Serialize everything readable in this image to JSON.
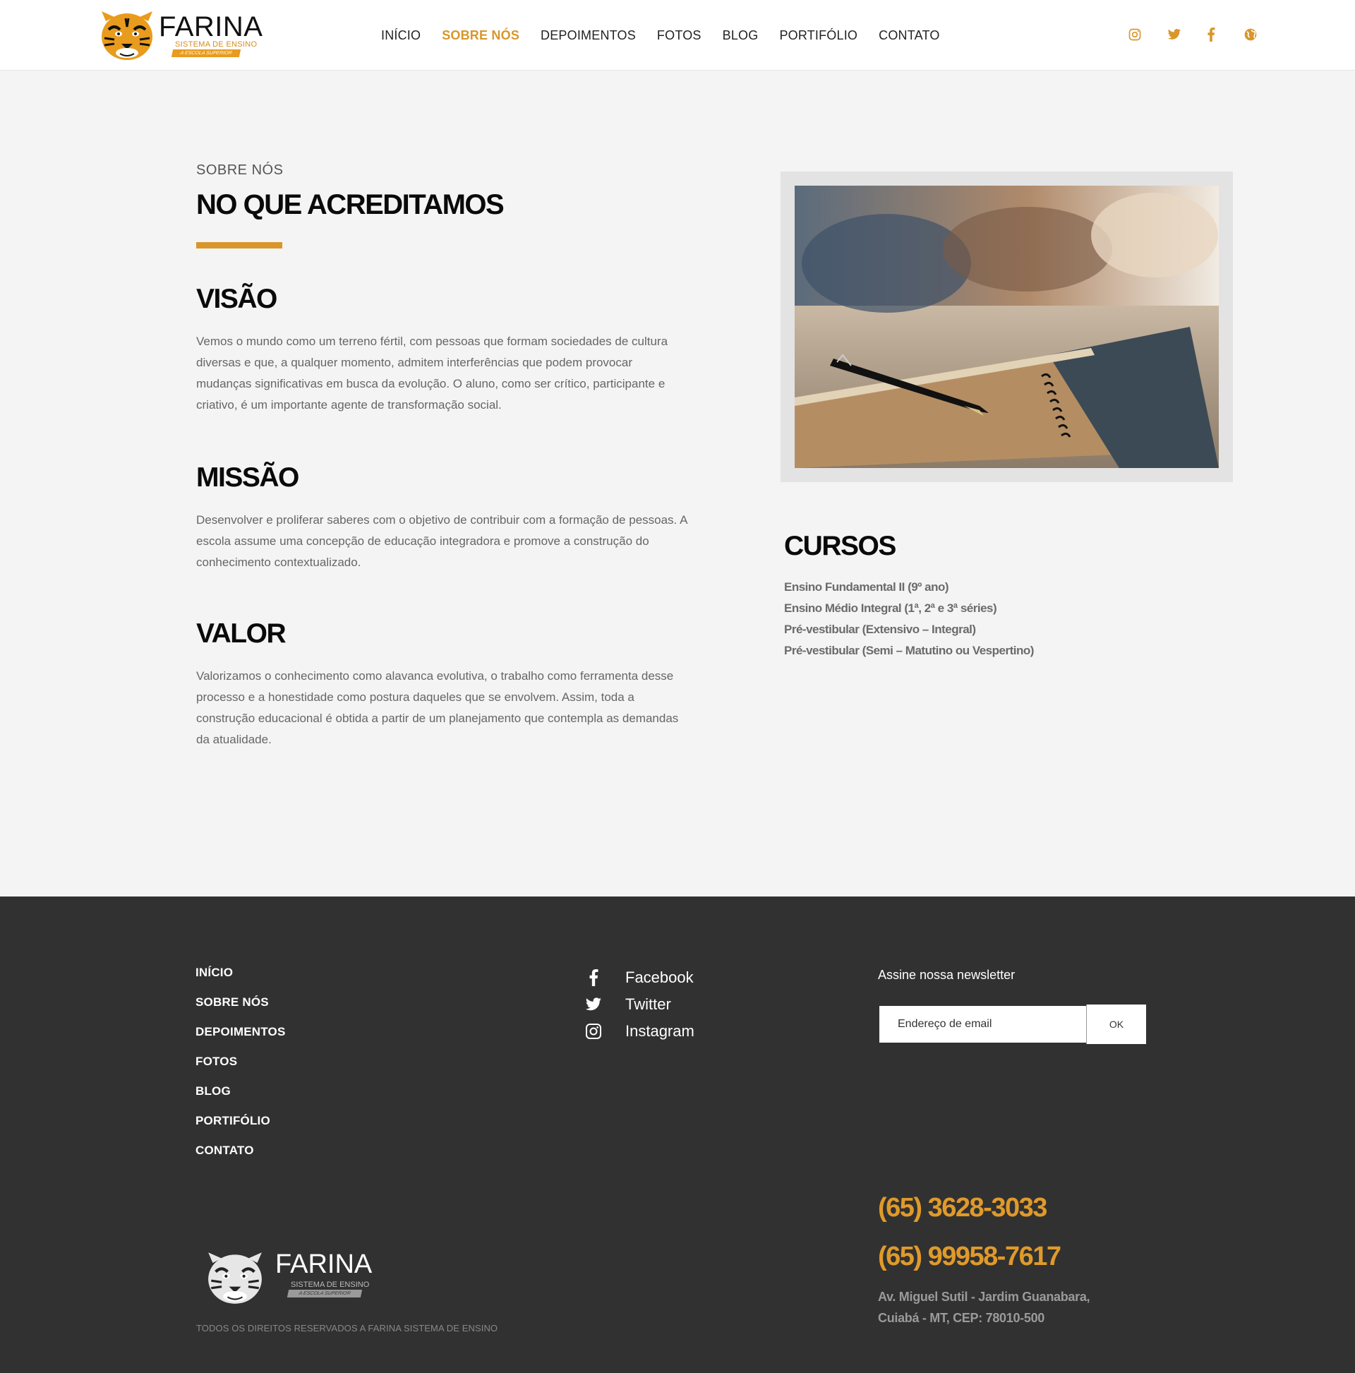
{
  "brand": {
    "name": "FARINA",
    "subtitle": "SISTEMA DE ENSINO",
    "tagline": "A ESCOLA SUPERIOR",
    "accent_color": "#d9962a"
  },
  "nav": {
    "items": [
      {
        "label": "INÍCIO",
        "active": false
      },
      {
        "label": "SOBRE NÓS",
        "active": true
      },
      {
        "label": "DEPOIMENTOS",
        "active": false
      },
      {
        "label": "FOTOS",
        "active": false
      },
      {
        "label": "BLOG",
        "active": false
      },
      {
        "label": "PORTIFÓLIO",
        "active": false
      },
      {
        "label": "CONTATO",
        "active": false
      }
    ],
    "social_icons": [
      "instagram-icon",
      "twitter-icon",
      "facebook-icon",
      "globe-icon"
    ]
  },
  "about": {
    "label": "SOBRE NÓS",
    "title": "NO QUE ACREDITAMOS",
    "blocks": [
      {
        "title": "VISÃO",
        "text": "Vemos o mundo como um terreno fértil, com pessoas que formam sociedades de cultura diversas e que, a qualquer momento, admitem interferências que podem provocar mudanças significativas em busca da evolução. O aluno, como ser crítico, participante e criativo, é um importante agente de transformação social."
      },
      {
        "title": "MISSÃO",
        "text": "Desenvolver e proliferar saberes com o objetivo de contribuir com a formação de pessoas. A escola assume uma concepção de educação integradora e promove a construção do conhecimento contextualizado."
      },
      {
        "title": "VALOR",
        "text": "Valorizamos o conhecimento como alavanca evolutiva, o trabalho como ferramenta desse processo e a honestidade como postura daqueles que se envolvem. Assim, toda a construção educacional é obtida a partir de um planejamento que contempla as demandas da atualidade."
      }
    ]
  },
  "cursos": {
    "title": "CURSOS",
    "items": [
      "Ensino Fundamental II (9º ano)",
      "Ensino Médio Integral (1ª, 2ª e 3ª séries)",
      "Pré-vestibular (Extensivo – Integral)",
      "Pré-vestibular (Semi – Matutino ou Vespertino)"
    ]
  },
  "footer": {
    "nav": [
      "INÍCIO",
      "SOBRE NÓS",
      "DEPOIMENTOS",
      "FOTOS",
      "BLOG",
      "PORTIFÓLIO",
      "CONTATO"
    ],
    "social": [
      {
        "icon": "facebook-icon",
        "label": "Facebook"
      },
      {
        "icon": "twitter-icon",
        "label": "Twitter"
      },
      {
        "icon": "instagram-icon",
        "label": "Instagram"
      }
    ],
    "newsletter": {
      "title": "Assine nossa newsletter",
      "placeholder": "Endereço de email",
      "button": "OK"
    },
    "phones": [
      "(65) 3628-3033",
      "(65) 99958-7617"
    ],
    "address_line1": "Av. Miguel Sutil - Jardim Guanabara,",
    "address_line2": "Cuiabá - MT,  CEP: 78010-500",
    "copyright": "TODOS OS DIREITOS RESERVADOS A FARINA SISTEMA DE ENSINO"
  }
}
